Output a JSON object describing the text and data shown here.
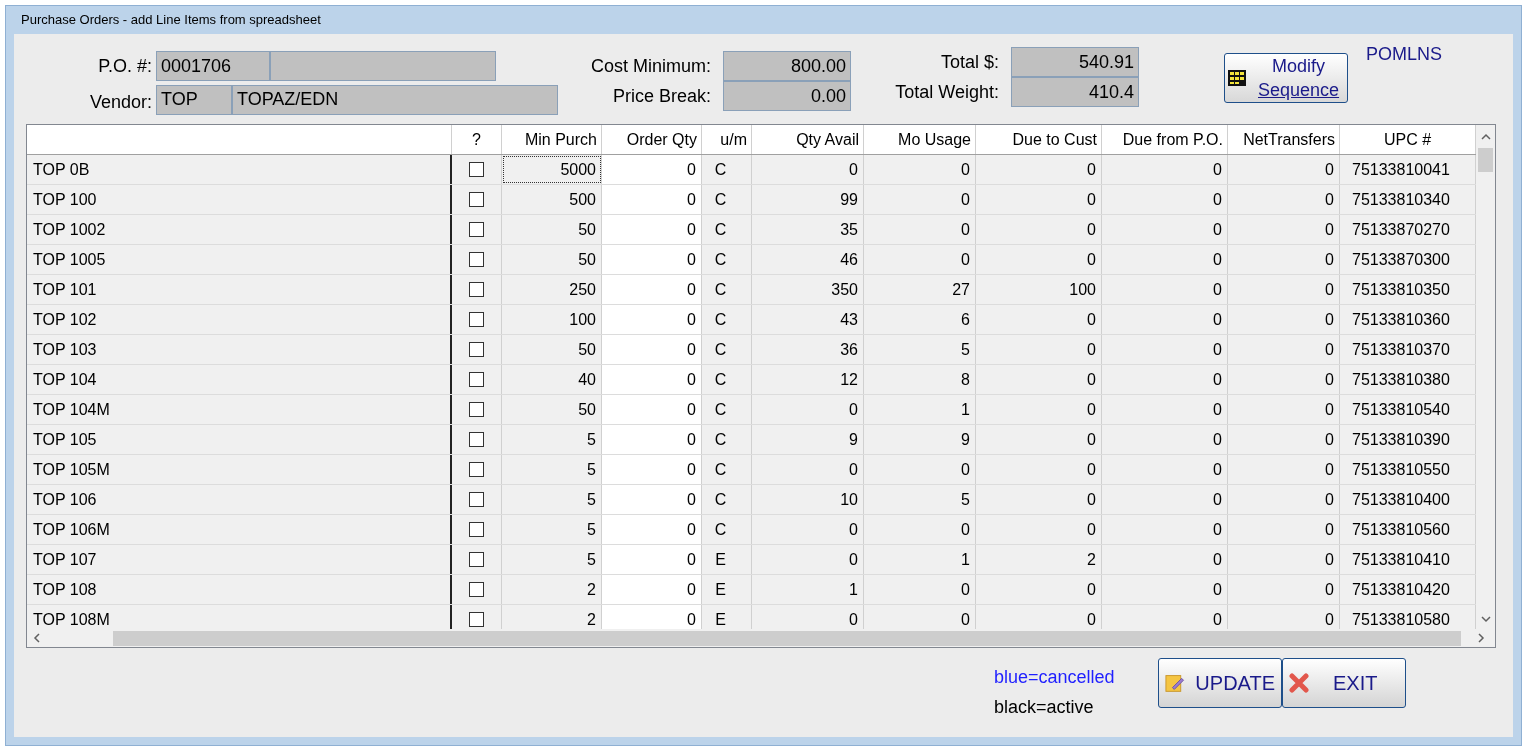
{
  "window": {
    "title": "Purchase Orders - add Line Items from spreadsheet"
  },
  "header": {
    "po_label": "P.O. #:",
    "po_number": "0001706",
    "vendor_label": "Vendor:",
    "vendor_code": "TOP",
    "vendor_name": "TOPAZ/EDN",
    "cost_minimum_label": "Cost Minimum:",
    "cost_minimum": "800.00",
    "price_break_label": "Price Break:",
    "price_break": "0.00",
    "total_label": "Total $:",
    "total": "540.91",
    "total_weight_label": "Total Weight:",
    "total_weight": "410.4",
    "modify_button": {
      "line1": "Modify",
      "line2": "Sequence"
    },
    "form_code": "POMLNS"
  },
  "table": {
    "columns": [
      "",
      "?",
      "Min Purch",
      "Order Qty",
      "u/m",
      "Qty Avail",
      "Mo Usage",
      "Due to Cust",
      "Due from P.O.",
      "NetTransfers",
      "UPC #"
    ],
    "rows": [
      {
        "checked": false,
        "focused": true,
        "cells": [
          "TOP 0B",
          "",
          "5000",
          "0",
          "C",
          "0",
          "0",
          "0",
          "0",
          "0",
          "75133810041"
        ]
      },
      {
        "checked": false,
        "focused": false,
        "cells": [
          "TOP 100",
          "",
          "500",
          "0",
          "C",
          "99",
          "0",
          "0",
          "0",
          "0",
          "75133810340"
        ]
      },
      {
        "checked": false,
        "focused": false,
        "cells": [
          "TOP 1002",
          "",
          "50",
          "0",
          "C",
          "35",
          "0",
          "0",
          "0",
          "0",
          "75133870270"
        ]
      },
      {
        "checked": false,
        "focused": false,
        "cells": [
          "TOP 1005",
          "",
          "50",
          "0",
          "C",
          "46",
          "0",
          "0",
          "0",
          "0",
          "75133870300"
        ]
      },
      {
        "checked": false,
        "focused": false,
        "cells": [
          "TOP 101",
          "",
          "250",
          "0",
          "C",
          "350",
          "27",
          "100",
          "0",
          "0",
          "75133810350"
        ]
      },
      {
        "checked": false,
        "focused": false,
        "cells": [
          "TOP 102",
          "",
          "100",
          "0",
          "C",
          "43",
          "6",
          "0",
          "0",
          "0",
          "75133810360"
        ]
      },
      {
        "checked": false,
        "focused": false,
        "cells": [
          "TOP 103",
          "",
          "50",
          "0",
          "C",
          "36",
          "5",
          "0",
          "0",
          "0",
          "75133810370"
        ]
      },
      {
        "checked": false,
        "focused": false,
        "cells": [
          "TOP 104",
          "",
          "40",
          "0",
          "C",
          "12",
          "8",
          "0",
          "0",
          "0",
          "75133810380"
        ]
      },
      {
        "checked": false,
        "focused": false,
        "cells": [
          "TOP 104M",
          "",
          "50",
          "0",
          "C",
          "0",
          "1",
          "0",
          "0",
          "0",
          "75133810540"
        ]
      },
      {
        "checked": false,
        "focused": false,
        "cells": [
          "TOP 105",
          "",
          "5",
          "0",
          "C",
          "9",
          "9",
          "0",
          "0",
          "0",
          "75133810390"
        ]
      },
      {
        "checked": false,
        "focused": false,
        "cells": [
          "TOP 105M",
          "",
          "5",
          "0",
          "C",
          "0",
          "0",
          "0",
          "0",
          "0",
          "75133810550"
        ]
      },
      {
        "checked": false,
        "focused": false,
        "cells": [
          "TOP 106",
          "",
          "5",
          "0",
          "C",
          "10",
          "5",
          "0",
          "0",
          "0",
          "75133810400"
        ]
      },
      {
        "checked": false,
        "focused": false,
        "cells": [
          "TOP 106M",
          "",
          "5",
          "0",
          "C",
          "0",
          "0",
          "0",
          "0",
          "0",
          "75133810560"
        ]
      },
      {
        "checked": false,
        "focused": false,
        "cells": [
          "TOP 107",
          "",
          "5",
          "0",
          "E",
          "0",
          "1",
          "2",
          "0",
          "0",
          "75133810410"
        ]
      },
      {
        "checked": false,
        "focused": false,
        "cells": [
          "TOP 108",
          "",
          "2",
          "0",
          "E",
          "1",
          "0",
          "0",
          "0",
          "0",
          "75133810420"
        ]
      },
      {
        "checked": false,
        "focused": false,
        "cells": [
          "TOP 108M",
          "",
          "2",
          "0",
          "E",
          "0",
          "0",
          "0",
          "0",
          "0",
          "75133810580"
        ]
      }
    ]
  },
  "legend": [
    {
      "text": "blue=cancelled",
      "color": "#1f1fff"
    },
    {
      "text": "black=active",
      "color": "#000000"
    }
  ],
  "buttons": [
    {
      "kind": "update",
      "label": "UPDATE"
    },
    {
      "kind": "exit",
      "label": "EXIT"
    }
  ]
}
